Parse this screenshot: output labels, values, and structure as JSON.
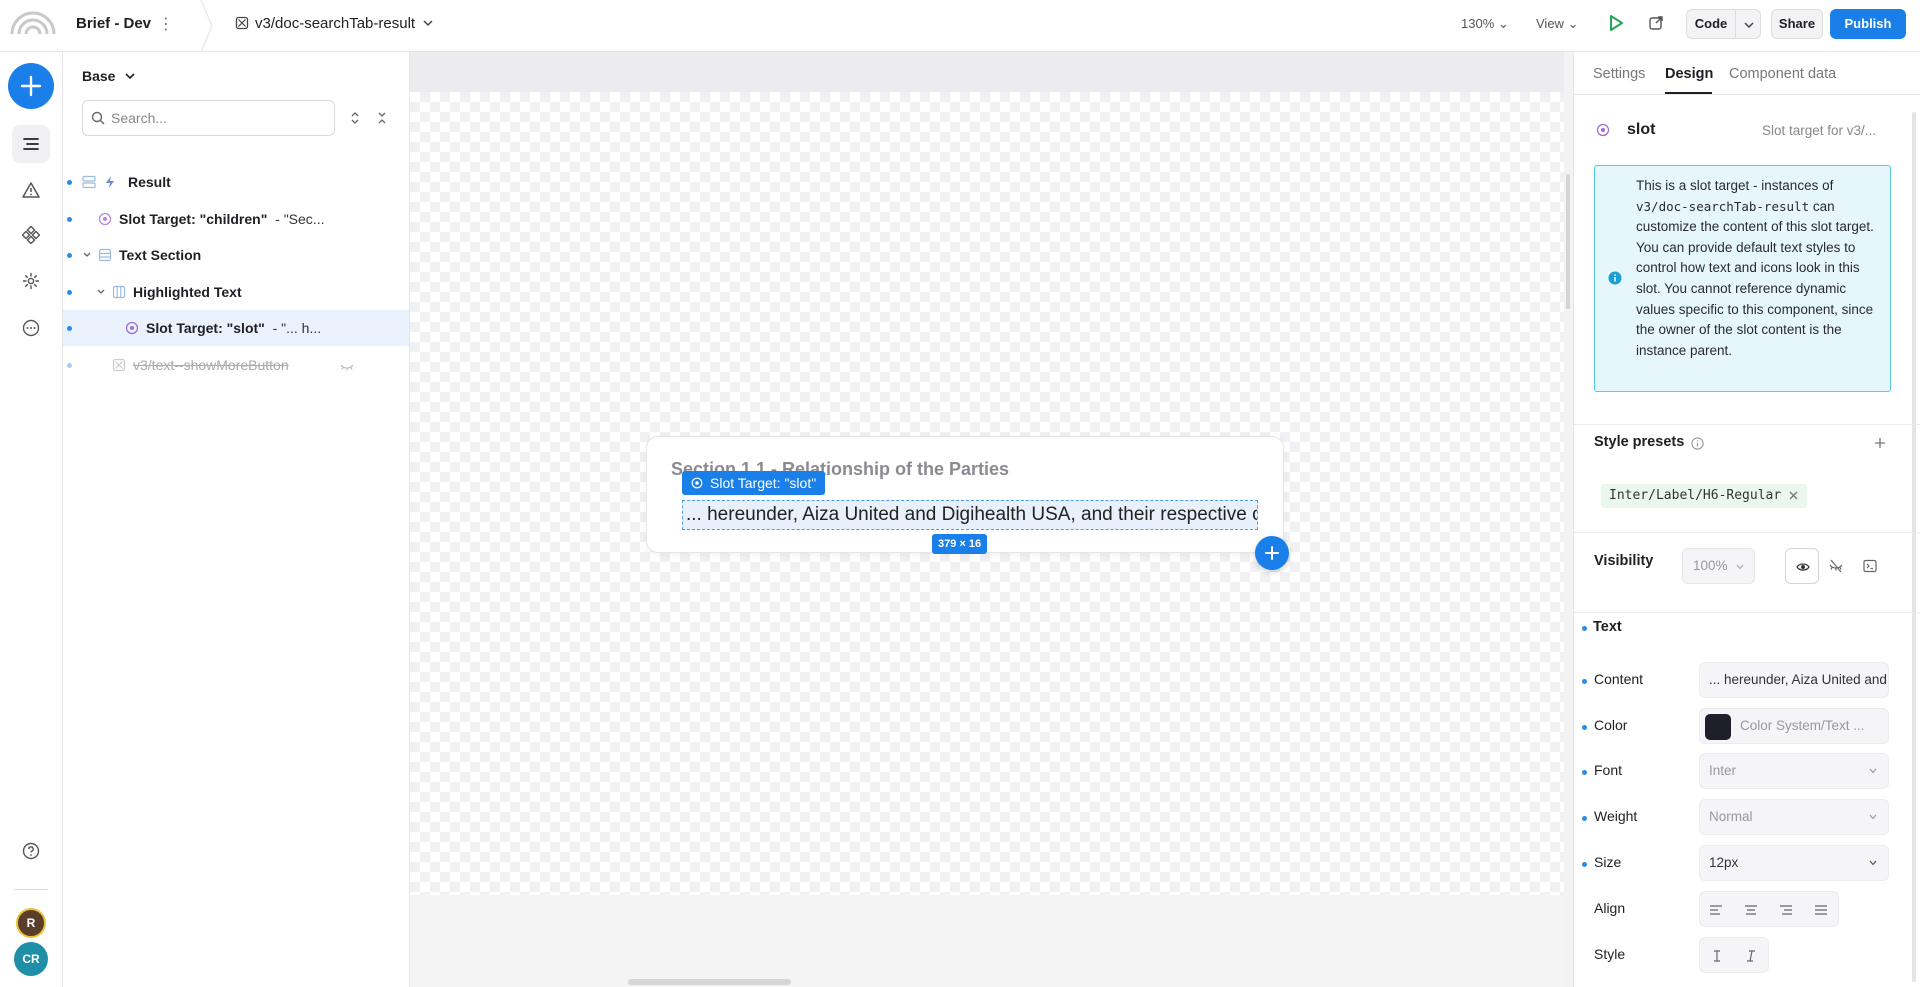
{
  "topbar": {
    "project_name": "Brief - Dev",
    "component_name": "v3/doc-searchTab-result",
    "zoom": "130%",
    "view_label": "View",
    "code_label": "Code",
    "share_label": "Share",
    "publish_label": "Publish"
  },
  "rail": {
    "avatars": [
      {
        "initials": "R",
        "color": "#5a3e2a"
      },
      {
        "initials": "CR",
        "color": "#1e8fa6"
      }
    ]
  },
  "outline": {
    "base_label": "Base",
    "search_placeholder": "Search...",
    "tree": [
      {
        "label": "Result",
        "sub": ""
      },
      {
        "label": "Slot Target: \"children\"",
        "sub": "  - \"Sec..."
      },
      {
        "label": "Text Section",
        "sub": ""
      },
      {
        "label": "Highlighted Text",
        "sub": ""
      },
      {
        "label": "Slot Target: \"slot\"",
        "sub": "  - \"... h..."
      },
      {
        "label": "v3/text--showMoreButton",
        "sub": ""
      }
    ]
  },
  "canvas": {
    "card_title": "Section 1.1 - Relationship of the Parties",
    "slot_tag": "Slot Target: \"slot\"",
    "slot_text": "... hereunder, Aiza United and Digihealth USA, and their respective officers, directors",
    "dimensions": "379 × 16"
  },
  "right": {
    "tabs": [
      "Settings",
      "Design",
      "Component data"
    ],
    "slot_name": "slot",
    "slot_desc": "Slot target for v3/...",
    "info_pre": "This is a slot target - instances of ",
    "info_code": "v3/doc-searchTab-result",
    "info_post": " can customize the content of this slot target. You can provide default text styles to control how text and icons look in this slot. You cannot reference dynamic values specific to this component, since the owner of the slot content is the instance parent.",
    "style_presets_title": "Style presets",
    "preset_chip": "Inter/Label/H6-Regular",
    "visibility_title": "Visibility",
    "visibility_value": "100%",
    "text_title": "Text",
    "props": {
      "content_label": "Content",
      "content_value": "... hereunder, Aiza United and Digihealth USA",
      "color_label": "Color",
      "color_value": "Color System/Text ...",
      "color_hex": "#1f1f2a",
      "font_label": "Font",
      "font_value": "Inter",
      "weight_label": "Weight",
      "weight_value": "Normal",
      "size_label": "Size",
      "size_value": "12px",
      "align_label": "Align",
      "style_label": "Style"
    }
  },
  "colors": {
    "accent": "#1a7fe8",
    "play_green": "#23a559",
    "info_bg": "#e5f7fb",
    "info_border": "#56c9e4"
  }
}
